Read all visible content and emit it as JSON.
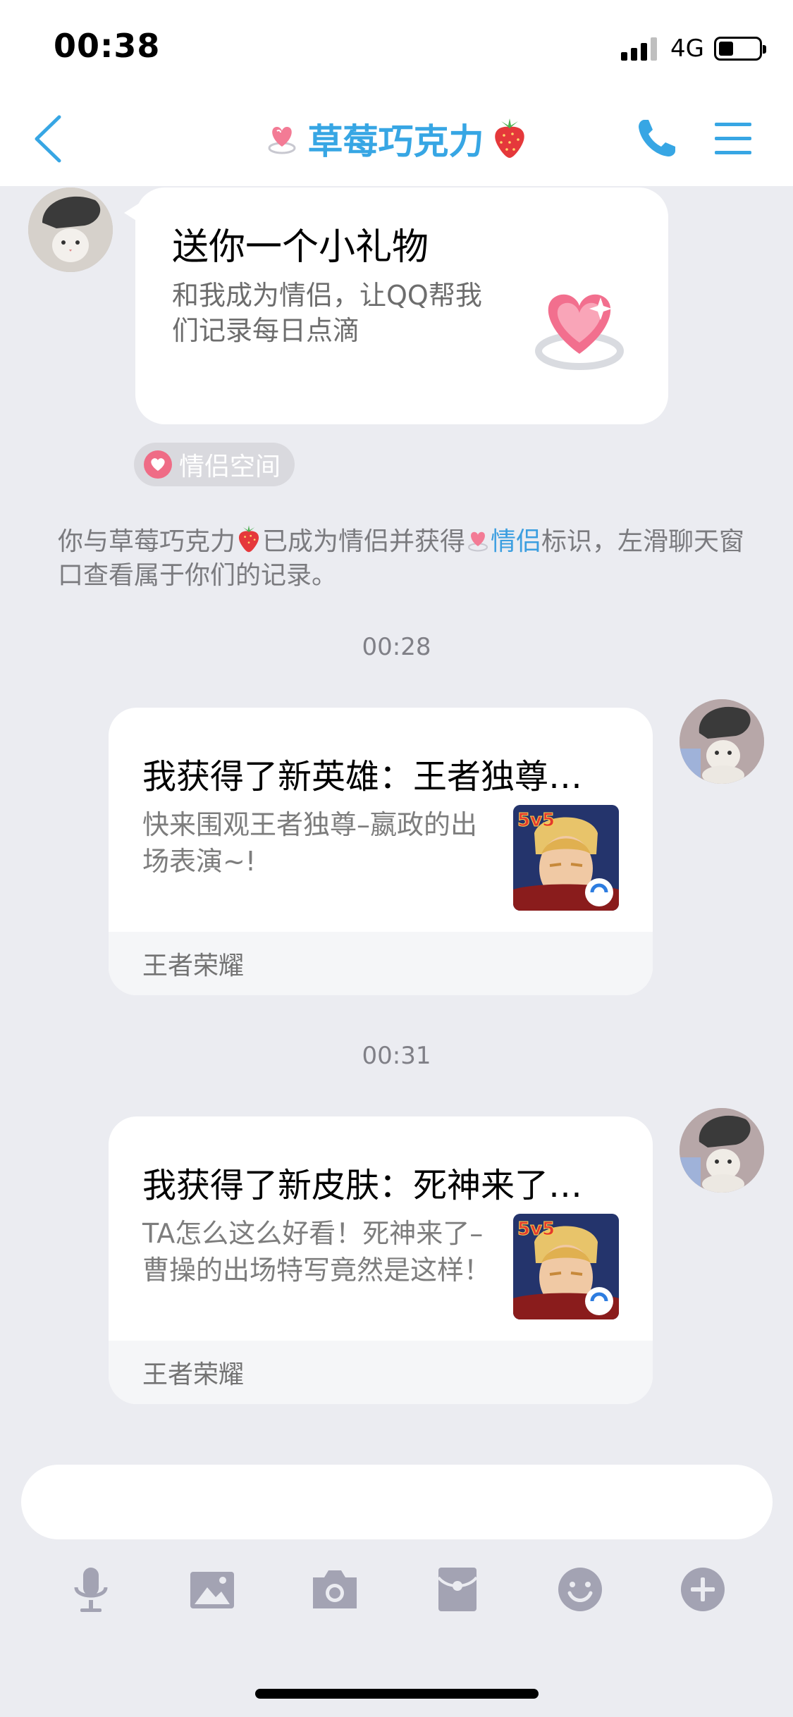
{
  "status_bar": {
    "time": "00:38",
    "network": "4G"
  },
  "nav": {
    "title": "草莓巧克力"
  },
  "gift_bubble": {
    "title": "送你一个小礼物",
    "description": "和我成为情侣，让QQ帮我们记录每日点滴"
  },
  "couple_tag": {
    "label": "情侣空间"
  },
  "system_message": {
    "part1": "你与草莓巧克力",
    "part2": "已成为情侣并获得",
    "badge": "情侣",
    "part3": "标识，左滑聊天窗口查看属于你们的记录。"
  },
  "messages": [
    {
      "timestamp": "00:28",
      "title": "我获得了新英雄：王者独尊…",
      "description": "快来围观王者独尊–嬴政的出场表演~!",
      "source": "王者荣耀",
      "thumb_badge": "5v5"
    },
    {
      "timestamp": "00:31",
      "title": "我获得了新皮肤：死神来了…",
      "description": "TA怎么这么好看！死神来了–曹操的出场特写竟然是这样！",
      "source": "王者荣耀",
      "thumb_badge": "5v5"
    }
  ],
  "input": {
    "placeholder": "",
    "value": ""
  },
  "toolbar": [
    "microphone-icon",
    "image-icon",
    "camera-icon",
    "red-packet-icon",
    "emoji-icon",
    "plus-icon"
  ],
  "colors": {
    "accent": "#37a6e4",
    "background": "#ebecf1",
    "icon_gray": "#a3a3b3",
    "love_pink": "#ef6c86"
  }
}
